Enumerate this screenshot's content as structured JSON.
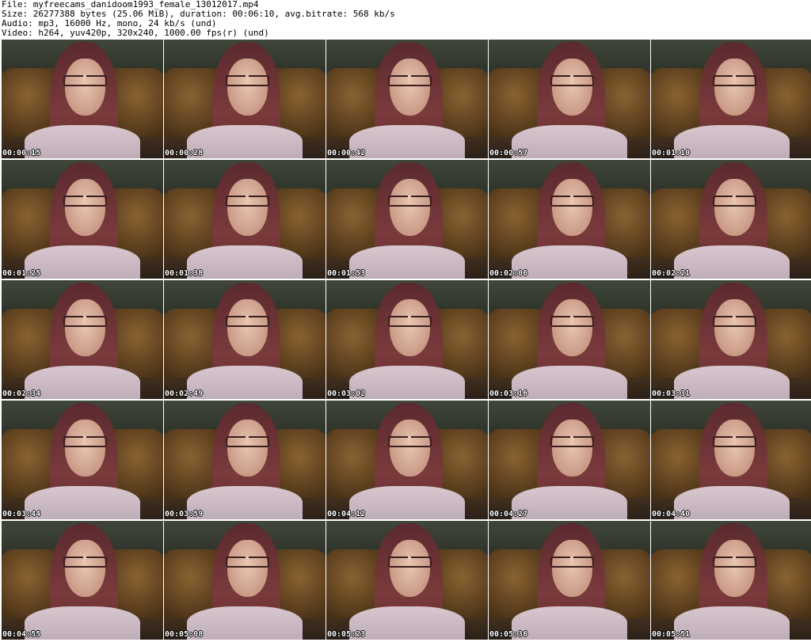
{
  "header": {
    "file_line": "File: myfreecams_danidoom1993_female_13012017.mp4",
    "size_line": "Size: 26277388 bytes (25.06 MiB), duration: 00:06:10, avg.bitrate: 568 kb/s",
    "audio_line": "Audio: mp3, 16000 Hz, mono, 24 kb/s (und)",
    "video_line": "Video: h264, yuv420p, 320x240, 1000.00 fps(r) (und)"
  },
  "thumbnails": [
    {
      "timestamp": "00:00:15"
    },
    {
      "timestamp": "00:00:28"
    },
    {
      "timestamp": "00:00:42"
    },
    {
      "timestamp": "00:00:57"
    },
    {
      "timestamp": "00:01:10"
    },
    {
      "timestamp": "00:01:25"
    },
    {
      "timestamp": "00:01:38"
    },
    {
      "timestamp": "00:01:53"
    },
    {
      "timestamp": "00:02:06"
    },
    {
      "timestamp": "00:02:21"
    },
    {
      "timestamp": "00:02:34"
    },
    {
      "timestamp": "00:02:49"
    },
    {
      "timestamp": "00:03:02"
    },
    {
      "timestamp": "00:03:16"
    },
    {
      "timestamp": "00:03:31"
    },
    {
      "timestamp": "00:03:44"
    },
    {
      "timestamp": "00:03:59"
    },
    {
      "timestamp": "00:04:12"
    },
    {
      "timestamp": "00:04:27"
    },
    {
      "timestamp": "00:04:40"
    },
    {
      "timestamp": "00:04:55"
    },
    {
      "timestamp": "00:05:08"
    },
    {
      "timestamp": "00:05:23"
    },
    {
      "timestamp": "00:05:36"
    },
    {
      "timestamp": "00:05:51"
    }
  ]
}
